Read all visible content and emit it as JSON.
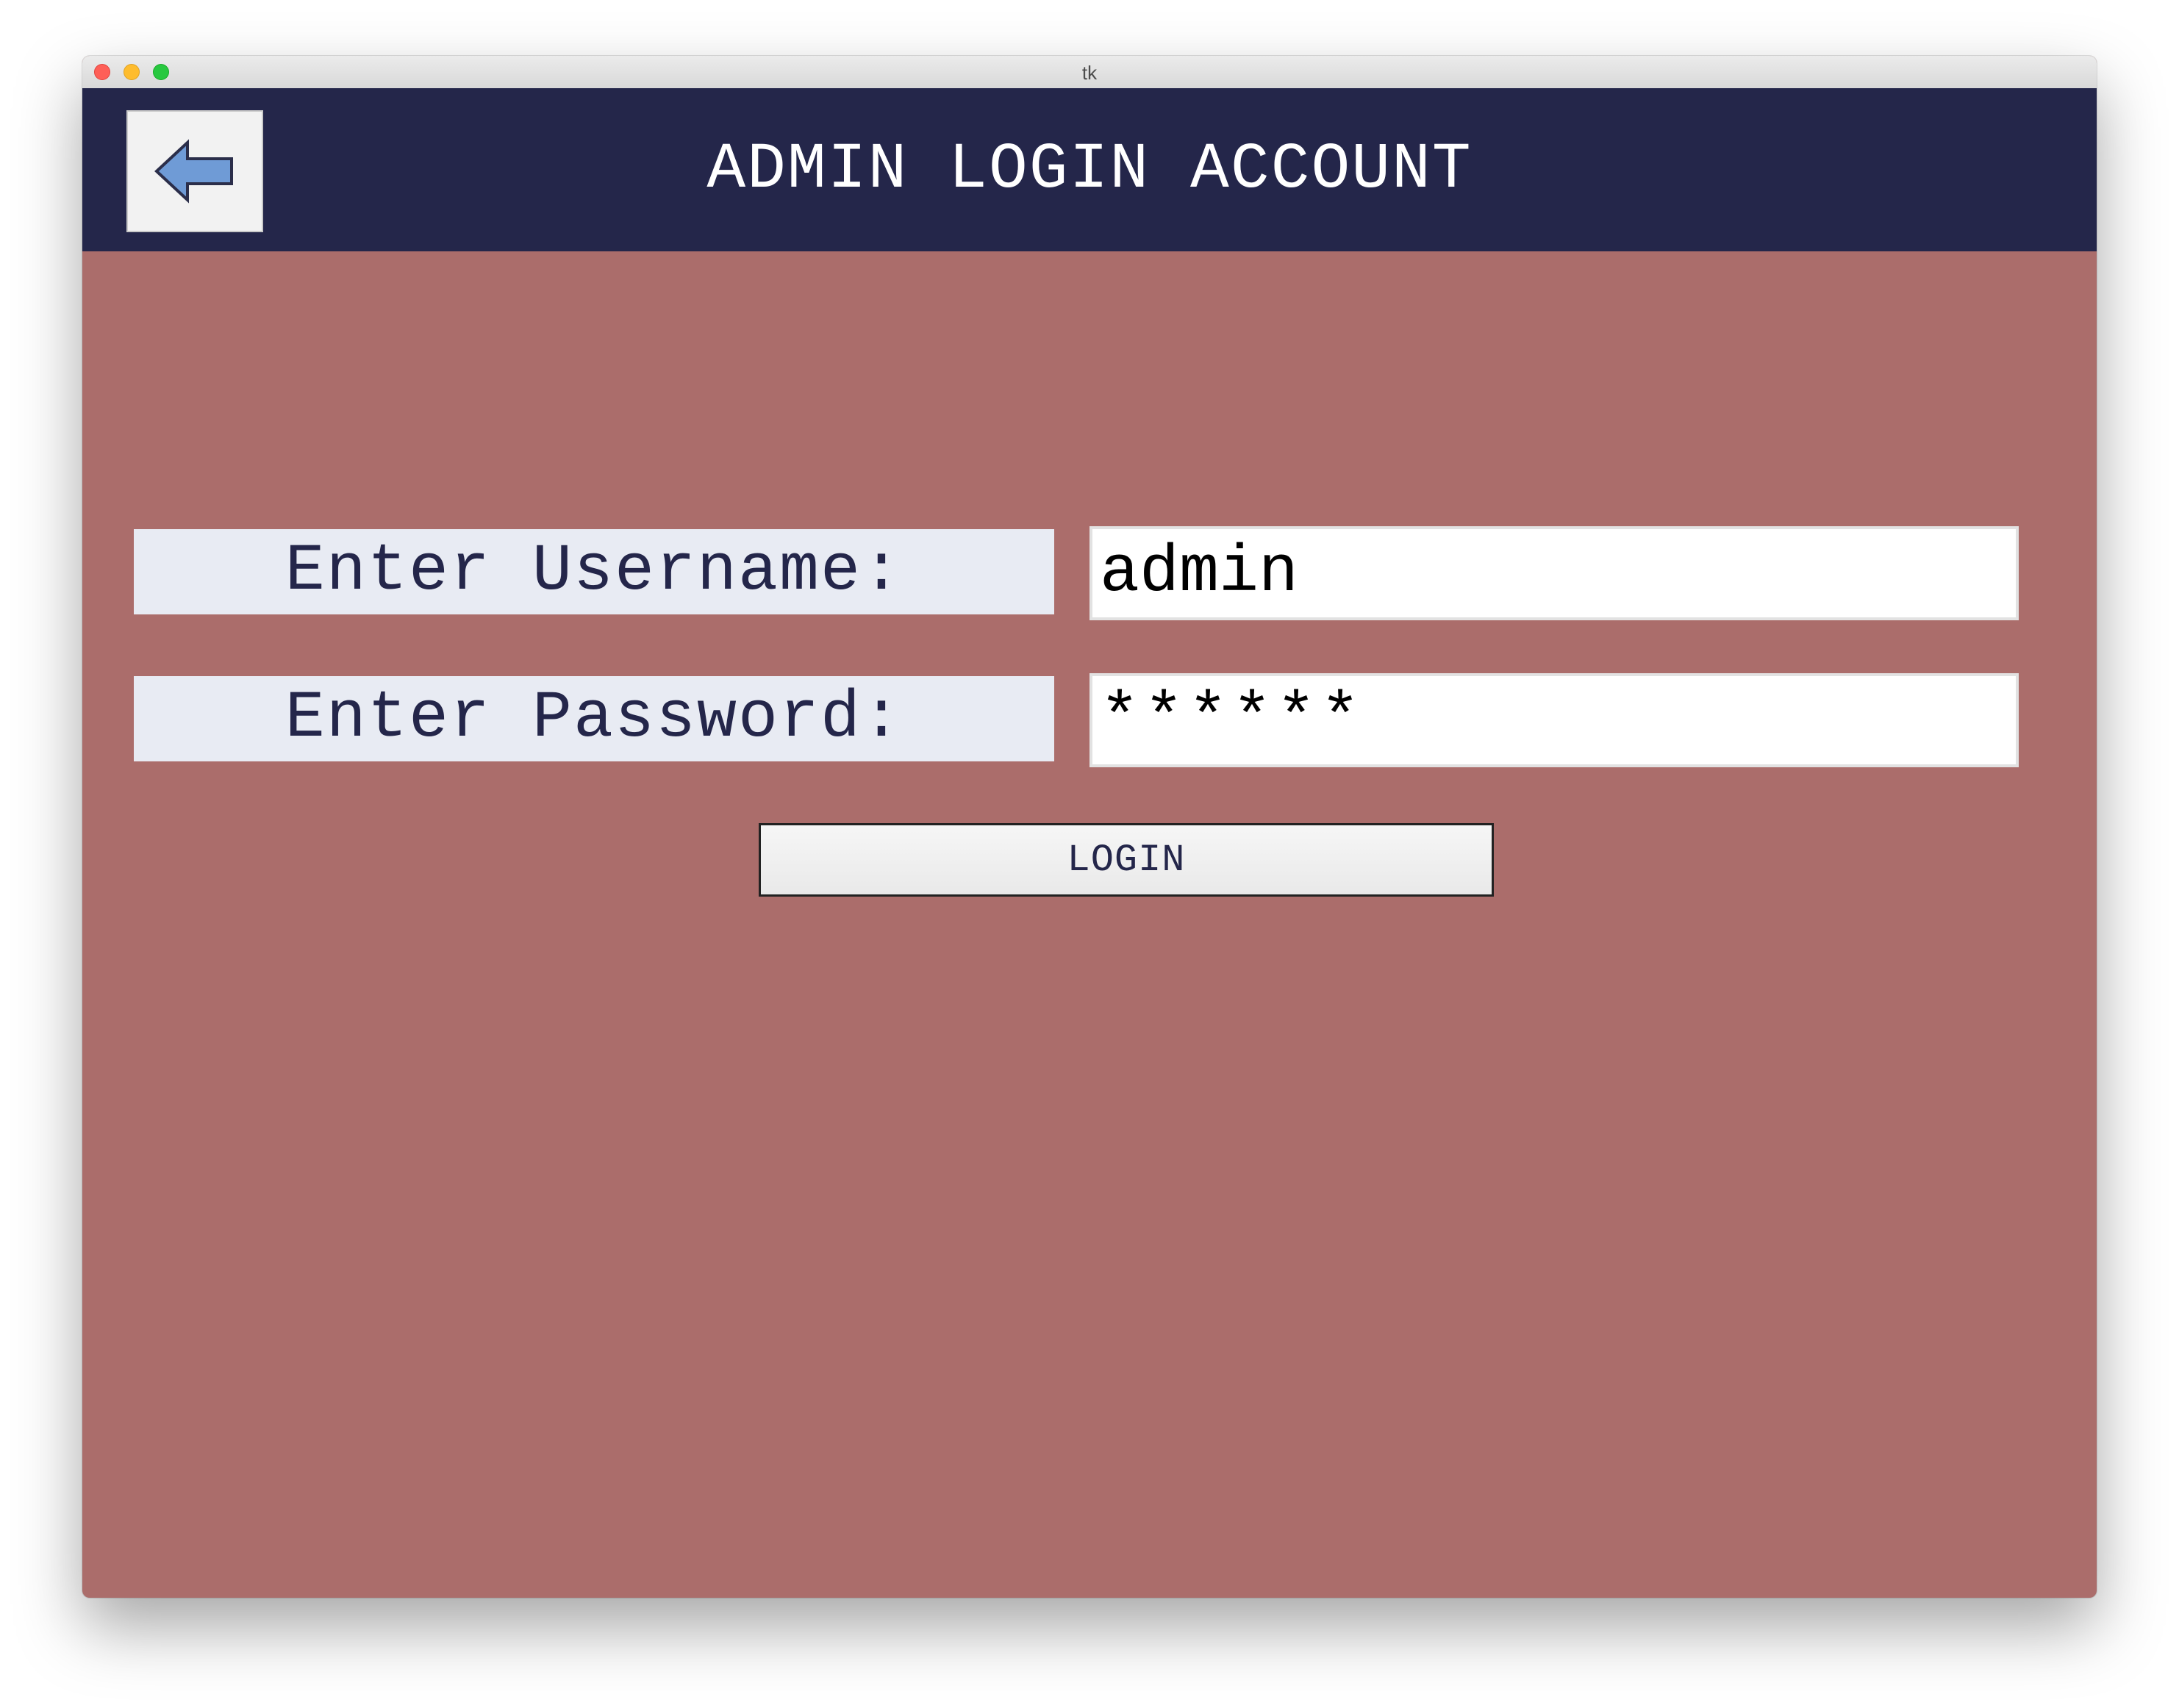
{
  "window": {
    "title": "tk"
  },
  "header": {
    "back_icon": "left-arrow-icon",
    "title": "ADMIN LOGIN ACCOUNT"
  },
  "form": {
    "username_label": "Enter Username:",
    "username_value": "admin",
    "password_label": "Enter Password:",
    "password_value": "******",
    "login_label": "LOGIN"
  },
  "colors": {
    "header_bg": "#24264a",
    "body_bg": "#ab6d6b",
    "label_bg": "#e8ebf3",
    "arrow_fill": "#6f9bd6"
  }
}
